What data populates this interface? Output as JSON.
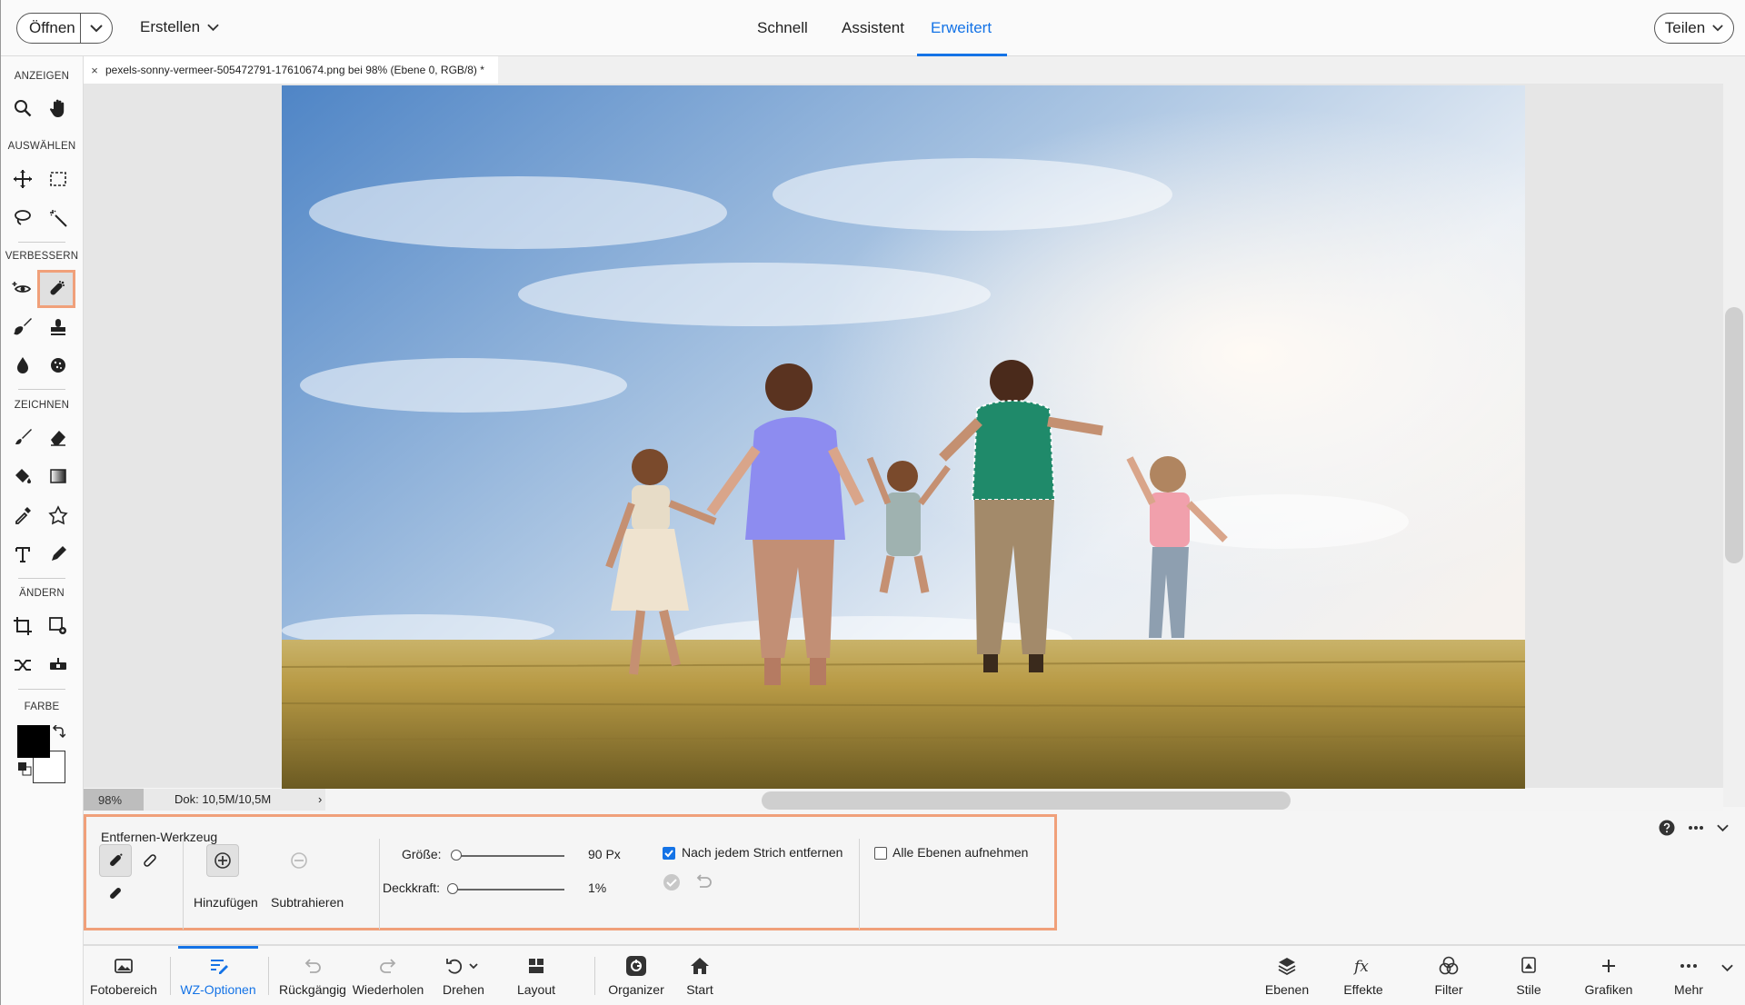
{
  "topbar": {
    "open_label": "Öffnen",
    "create_label": "Erstellen",
    "modes": [
      "Schnell",
      "Assistent",
      "Erweitert"
    ],
    "active_mode": "Erweitert",
    "share_label": "Teilen"
  },
  "toolbar": {
    "sections": {
      "view": "ANZEIGEN",
      "select": "AUSWÄHLEN",
      "enhance": "VERBESSERN",
      "draw": "ZEICHNEN",
      "modify": "ÄNDERN",
      "color": "FARBE"
    },
    "active_tool": "remove-tool",
    "foreground_color": "#000000",
    "background_color": "#ffffff"
  },
  "document": {
    "tab_title": "pexels-sonny-vermeer-505472791-17610674.png bei 98% (Ebene 0, RGB/8) *",
    "close_glyph": "×"
  },
  "status": {
    "zoom": "98%",
    "doc_size": "Dok: 10,5M/10,5M",
    "chevron": "›"
  },
  "options": {
    "tool_name": "Entfernen-Werkzeug",
    "add_label": "Hinzufügen",
    "subtract_label": "Subtrahieren",
    "size_label": "Größe:",
    "size_value": "90 Px",
    "opacity_label": "Deckkraft:",
    "opacity_value": "1%",
    "remove_after_stroke_label": "Nach jedem Strich entfernen",
    "remove_after_stroke_checked": true,
    "sample_all_layers_label": "Alle Ebenen aufnehmen",
    "sample_all_layers_checked": false
  },
  "bottombar": {
    "photo_bin": "Fotobereich",
    "tool_options": "WZ-Optionen",
    "undo": "Rückgängig",
    "redo": "Wiederholen",
    "rotate": "Drehen",
    "layout": "Layout",
    "organizer": "Organizer",
    "home": "Start",
    "layers": "Ebenen",
    "effects": "Effekte",
    "filters": "Filter",
    "styles": "Stile",
    "graphics": "Grafiken",
    "more": "Mehr"
  },
  "colors": {
    "accent": "#1473e6",
    "highlight": "#f0a07a"
  }
}
